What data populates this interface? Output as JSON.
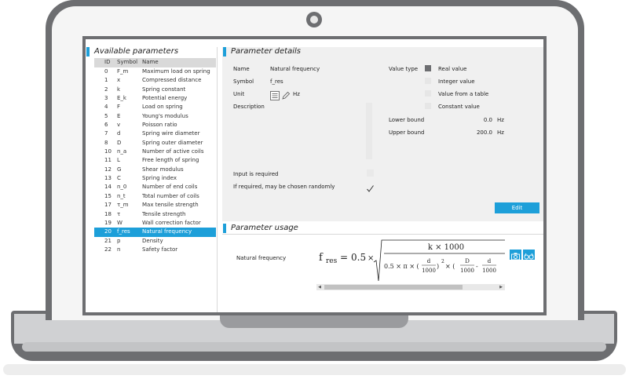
{
  "left_panel": {
    "title": "Available parameters",
    "columns": [
      "ID",
      "Symbol",
      "Name"
    ],
    "rows": [
      {
        "id": "0",
        "symbol": "F_m",
        "name": "Maximum load on spring"
      },
      {
        "id": "1",
        "symbol": "x",
        "name": "Compressed distance"
      },
      {
        "id": "2",
        "symbol": "k",
        "name": "Spring constant"
      },
      {
        "id": "3",
        "symbol": "E_k",
        "name": "Potential energy"
      },
      {
        "id": "4",
        "symbol": "F",
        "name": "Load on spring"
      },
      {
        "id": "5",
        "symbol": "E",
        "name": "Young's modulus"
      },
      {
        "id": "6",
        "symbol": "v",
        "name": "Poisson ratio"
      },
      {
        "id": "7",
        "symbol": "d",
        "name": "Spring wire diameter"
      },
      {
        "id": "8",
        "symbol": "D",
        "name": "Spring outer diameter"
      },
      {
        "id": "10",
        "symbol": "n_a",
        "name": "Number of active coils"
      },
      {
        "id": "11",
        "symbol": "L",
        "name": "Free length of spring"
      },
      {
        "id": "12",
        "symbol": "G",
        "name": "Shear modulus"
      },
      {
        "id": "13",
        "symbol": "C",
        "name": "Spring index"
      },
      {
        "id": "14",
        "symbol": "n_0",
        "name": "Number of end coils"
      },
      {
        "id": "15",
        "symbol": "n_t",
        "name": "Total number of coils"
      },
      {
        "id": "17",
        "symbol": "τ_m",
        "name": "Max tensile strength"
      },
      {
        "id": "18",
        "symbol": "τ",
        "name": "Tensile strength"
      },
      {
        "id": "19",
        "symbol": "W",
        "name": "Wall correction factor"
      },
      {
        "id": "20",
        "symbol": "f_res",
        "name": "Natural frequency"
      },
      {
        "id": "21",
        "symbol": "p",
        "name": "Density"
      },
      {
        "id": "22",
        "symbol": "n",
        "name": "Safety factor"
      }
    ],
    "selected_index": 18
  },
  "details": {
    "title": "Parameter details",
    "name_label": "Name",
    "name_value": "Natural frequency",
    "symbol_label": "Symbol",
    "symbol_value": "f_res",
    "unit_label": "Unit",
    "unit_value": "Hz",
    "description_label": "Description",
    "input_required_label": "Input is required",
    "random_label": "If required, may be chosen randomly",
    "value_type_label": "Value type",
    "value_types": [
      "Real value",
      "Integer value",
      "Value from a table",
      "Constant value"
    ],
    "value_type_selected": 0,
    "lower_bound_label": "Lower bound",
    "lower_bound_value": "0.0",
    "lower_bound_unit": "Hz",
    "upper_bound_label": "Upper bound",
    "upper_bound_value": "200.0",
    "upper_bound_unit": "Hz",
    "edit_label": "Edit"
  },
  "usage": {
    "title": "Parameter usage",
    "row_label": "Natural frequency",
    "formula": {
      "lhs": "f",
      "lhs_sub": "res",
      "eq": "=",
      "coef": "0.5",
      "times": "×",
      "numerator": "k × 1000",
      "den_text": "0.5 × π × (",
      "frac1_num": "d",
      "frac1_den": "1000",
      "close_paren": ")",
      "sq": "2",
      "times2": " × (",
      "frac2_num": "D",
      "frac2_den": "1000",
      "minus": "-",
      "frac3_num": "d",
      "frac3_den": "1000"
    }
  },
  "colors": {
    "accent": "#1d9fd9",
    "frame": "#6d6e71"
  }
}
